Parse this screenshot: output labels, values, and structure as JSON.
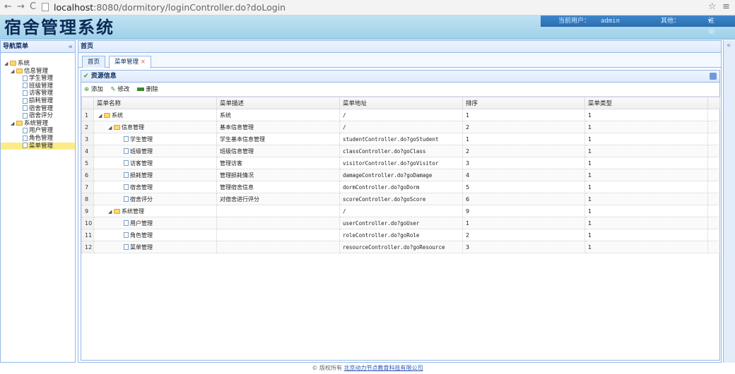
{
  "browser": {
    "host": "localhost",
    "path": ":8080/dormitory/loginController.do?doLogin"
  },
  "header": {
    "app_title": "宿舍管理系统",
    "current_user_label": "当前用户：",
    "current_user": "admin",
    "other_label": "其他：",
    "logout": "注销"
  },
  "west": {
    "title": "导航菜单",
    "tree": [
      {
        "label": "系统",
        "type": "folder",
        "depth": 0,
        "expanded": true
      },
      {
        "label": "信息管理",
        "type": "folder",
        "depth": 1,
        "expanded": true
      },
      {
        "label": "学生管理",
        "type": "file",
        "depth": 2
      },
      {
        "label": "班级管理",
        "type": "file",
        "depth": 2
      },
      {
        "label": "访客管理",
        "type": "file",
        "depth": 2
      },
      {
        "label": "损耗管理",
        "type": "file",
        "depth": 2
      },
      {
        "label": "宿舍管理",
        "type": "file",
        "depth": 2
      },
      {
        "label": "宿舍评分",
        "type": "file",
        "depth": 2
      },
      {
        "label": "系统管理",
        "type": "folder",
        "depth": 1,
        "expanded": true
      },
      {
        "label": "用户管理",
        "type": "file",
        "depth": 2
      },
      {
        "label": "角色管理",
        "type": "file",
        "depth": 2
      },
      {
        "label": "菜单管理",
        "type": "file",
        "depth": 2,
        "selected": true
      }
    ]
  },
  "center": {
    "title": "首页",
    "tabs": [
      {
        "label": "首页",
        "active": false
      },
      {
        "label": "菜单管理",
        "active": true,
        "close": "×"
      }
    ],
    "grid_title": "资源信息",
    "toolbar": {
      "add": "添加",
      "edit": "修改",
      "delete": "删除"
    },
    "columns": [
      "菜单名称",
      "菜单描述",
      "菜单地址",
      "排序",
      "菜单类型"
    ],
    "rows": [
      {
        "n": "1",
        "name": "系统",
        "desc": "系统",
        "url": "/",
        "order": "1",
        "type": "1",
        "kind": "folder",
        "depth": 0
      },
      {
        "n": "2",
        "name": "信息管理",
        "desc": "基本信息管理",
        "url": "/",
        "order": "2",
        "type": "1",
        "kind": "folder",
        "depth": 1
      },
      {
        "n": "3",
        "name": "学生管理",
        "desc": "学生基本信息管理",
        "url": "studentController.do?goStudent",
        "order": "1",
        "type": "1",
        "kind": "file",
        "depth": 2
      },
      {
        "n": "4",
        "name": "班级管理",
        "desc": "班级信息管理",
        "url": "classController.do?goClass",
        "order": "2",
        "type": "1",
        "kind": "file",
        "depth": 2
      },
      {
        "n": "5",
        "name": "访客管理",
        "desc": "管理访客",
        "url": "visitorController.do?goVisitor",
        "order": "3",
        "type": "1",
        "kind": "file",
        "depth": 2
      },
      {
        "n": "6",
        "name": "损耗管理",
        "desc": "管理损耗情况",
        "url": "damageController.do?goDamage",
        "order": "4",
        "type": "1",
        "kind": "file",
        "depth": 2
      },
      {
        "n": "7",
        "name": "宿舍管理",
        "desc": "管理宿舍信息",
        "url": "dormController.do?goDorm",
        "order": "5",
        "type": "1",
        "kind": "file",
        "depth": 2
      },
      {
        "n": "8",
        "name": "宿舍评分",
        "desc": "对宿舍进行评分",
        "url": "scoreController.do?goScore",
        "order": "6",
        "type": "1",
        "kind": "file",
        "depth": 2
      },
      {
        "n": "9",
        "name": "系统管理",
        "desc": "",
        "url": "/",
        "order": "9",
        "type": "1",
        "kind": "folder",
        "depth": 1
      },
      {
        "n": "10",
        "name": "用户管理",
        "desc": "",
        "url": "userController.do?goUser",
        "order": "1",
        "type": "1",
        "kind": "file",
        "depth": 2
      },
      {
        "n": "11",
        "name": "角色管理",
        "desc": "",
        "url": "roleController.do?goRole",
        "order": "2",
        "type": "1",
        "kind": "file",
        "depth": 2
      },
      {
        "n": "12",
        "name": "菜单管理",
        "desc": "",
        "url": "resourceController.do?goResource",
        "order": "3",
        "type": "1",
        "kind": "file",
        "depth": 2
      }
    ]
  },
  "footer": {
    "prefix": "© 版权所有",
    "link": "北京动力节点教育科技有限公司"
  }
}
